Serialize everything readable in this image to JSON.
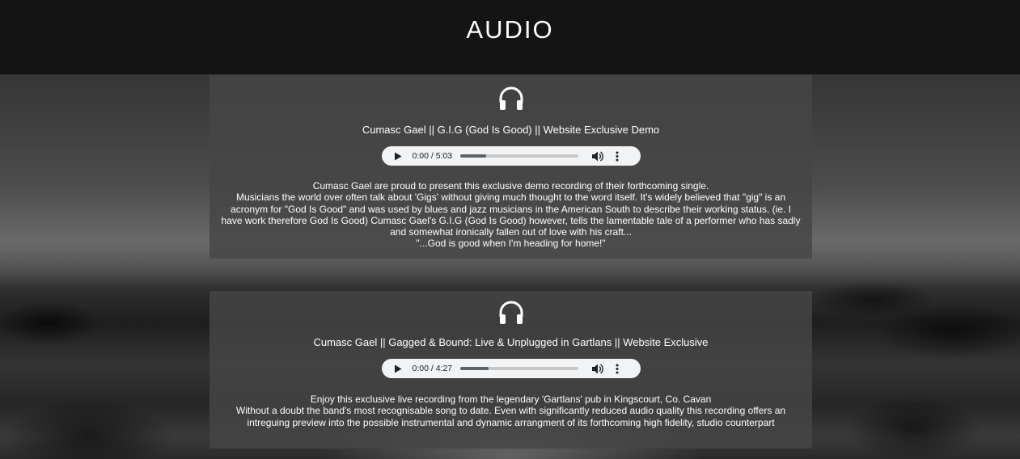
{
  "header": {
    "title": "AUDIO"
  },
  "tracks": [
    {
      "icon": "headphones-icon",
      "title": "Cumasc Gael || G.I.G (God Is Good) || Website Exclusive Demo",
      "player": {
        "time": "0:00 / 5:03",
        "progress": 0.22
      },
      "description": [
        "Cumasc Gael are proud to present this exclusive demo recording of their forthcoming single.",
        "Musicians the world over often talk about 'Gigs' without giving much thought to the word itself. It's widely believed that \"gig\" is an acronym for \"God Is Good\" and was used by blues and jazz musicians in the American South to describe their working status. (ie. I have work therefore God Is Good) Cumasc Gael's G.I.G (God Is Good) however, tells the lamentable tale of a performer who has sadly and somewhat ironically fallen out of love with his craft...",
        "\"...God is good when I'm heading for home!\""
      ]
    },
    {
      "icon": "headphones-icon",
      "title": "Cumasc Gael || Gagged & Bound: Live & Unplugged in Gartlans || Website Exclusive",
      "player": {
        "time": "0:00 / 4:27",
        "progress": 0.24
      },
      "description": [
        "Enjoy this exclusive live recording from the legendary 'Gartlans' pub in Kingscourt, Co. Cavan",
        "Without a doubt the band's most recognisable song to date. Even with significantly reduced audio quality this recording offers an intreguing preview into the possible instrumental and dynamic arrangment of its forthcoming high fidelity, studio counterpart"
      ]
    }
  ]
}
